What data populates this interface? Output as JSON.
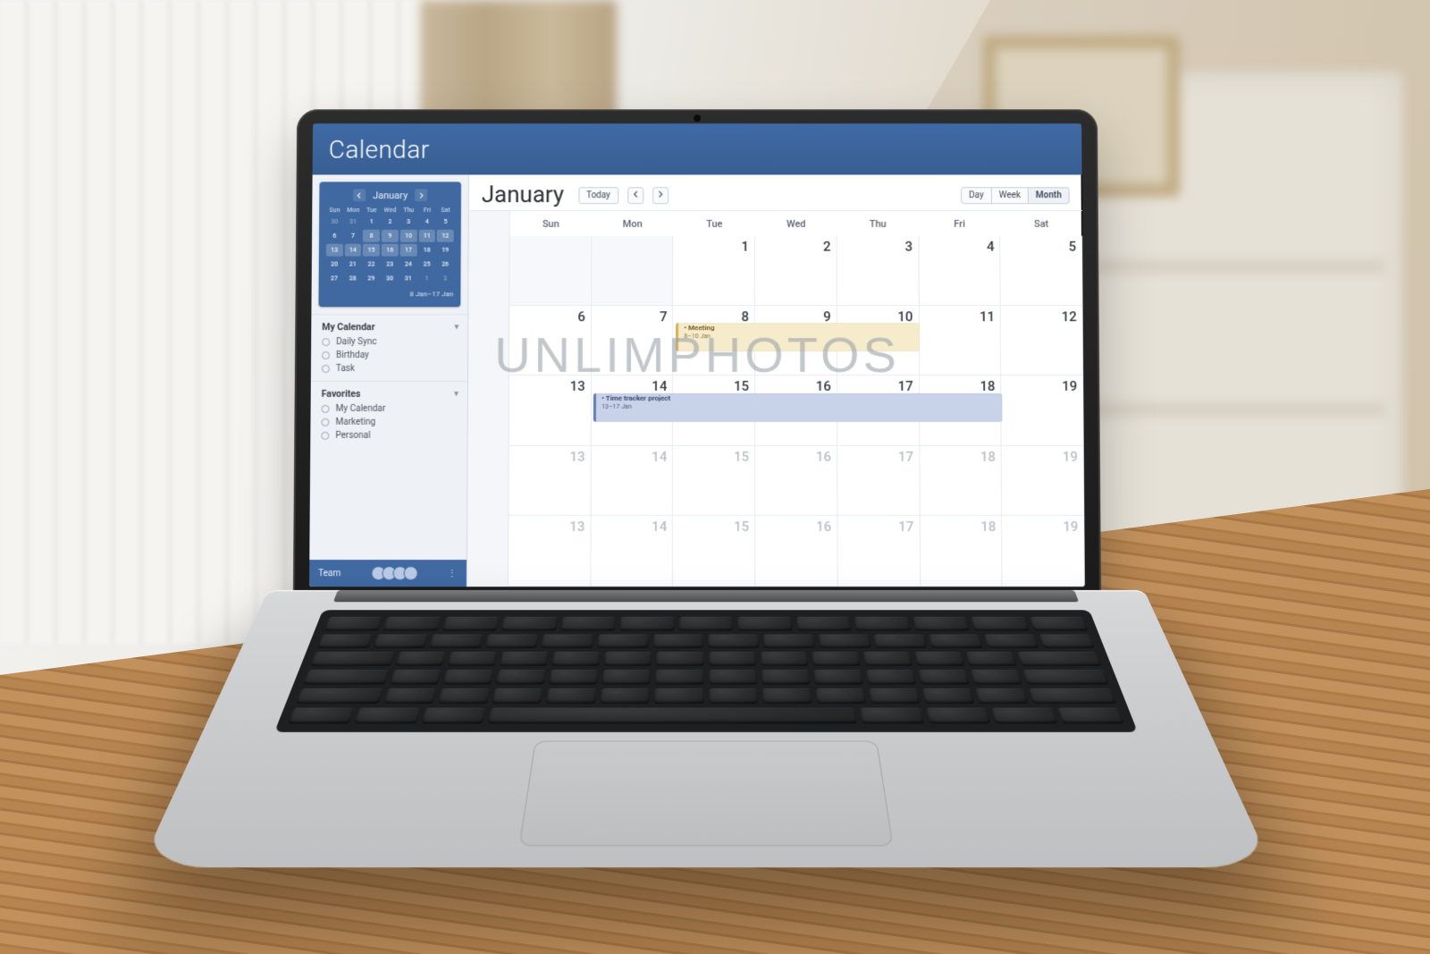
{
  "app_title": "Calendar",
  "watermark": {
    "main": "UNLIMPHOTOS",
    "corner": "UNL"
  },
  "mini": {
    "month": "January",
    "dow": [
      "Sun",
      "Mon",
      "Tue",
      "Wed",
      "Thu",
      "Fri",
      "Sat"
    ],
    "range_label": "8 Jan–17 Jan",
    "cells": [
      {
        "n": "30",
        "dim": true
      },
      {
        "n": "31",
        "dim": true
      },
      {
        "n": "1"
      },
      {
        "n": "2"
      },
      {
        "n": "3"
      },
      {
        "n": "4"
      },
      {
        "n": "5"
      },
      {
        "n": "6"
      },
      {
        "n": "7"
      },
      {
        "n": "8",
        "hl": true
      },
      {
        "n": "9",
        "hl": true
      },
      {
        "n": "10",
        "hl": true
      },
      {
        "n": "11",
        "hl": true
      },
      {
        "n": "12",
        "hl": true
      },
      {
        "n": "13",
        "hl": true
      },
      {
        "n": "14",
        "hl": true
      },
      {
        "n": "15",
        "hl": true
      },
      {
        "n": "16",
        "hl": true
      },
      {
        "n": "17",
        "hl": true
      },
      {
        "n": "18"
      },
      {
        "n": "19"
      },
      {
        "n": "20"
      },
      {
        "n": "21"
      },
      {
        "n": "22"
      },
      {
        "n": "23"
      },
      {
        "n": "24"
      },
      {
        "n": "25"
      },
      {
        "n": "26"
      },
      {
        "n": "27"
      },
      {
        "n": "28"
      },
      {
        "n": "29"
      },
      {
        "n": "30"
      },
      {
        "n": "31"
      },
      {
        "n": "1",
        "dim": true
      },
      {
        "n": "2",
        "dim": true
      }
    ]
  },
  "sections": [
    {
      "title": "My Calendar",
      "items": [
        "Daily Sync",
        "Birthday",
        "Task"
      ]
    },
    {
      "title": "Favorites",
      "items": [
        "My Calendar",
        "Marketing",
        "Personal"
      ]
    }
  ],
  "team_label": "Team",
  "toolbar": {
    "month": "January",
    "today": "Today",
    "views": [
      "Day",
      "Week",
      "Month"
    ],
    "active_view": "Month"
  },
  "dow": [
    "Sun",
    "Mon",
    "Tue",
    "Wed",
    "Thu",
    "Fri",
    "Sat"
  ],
  "weeks": [
    [
      {
        "n": ""
      },
      {
        "n": ""
      },
      {
        "n": "1"
      },
      {
        "n": "2"
      },
      {
        "n": "3"
      },
      {
        "n": "4"
      },
      {
        "n": "5"
      }
    ],
    [
      {
        "n": "6"
      },
      {
        "n": "7"
      },
      {
        "n": "8"
      },
      {
        "n": "9"
      },
      {
        "n": "10"
      },
      {
        "n": "11"
      },
      {
        "n": "12"
      }
    ],
    [
      {
        "n": "13"
      },
      {
        "n": "14"
      },
      {
        "n": "15"
      },
      {
        "n": "16"
      },
      {
        "n": "17"
      },
      {
        "n": "18"
      },
      {
        "n": "19"
      }
    ],
    [
      {
        "n": "13",
        "dim": true
      },
      {
        "n": "14",
        "dim": true
      },
      {
        "n": "15",
        "dim": true
      },
      {
        "n": "16",
        "dim": true
      },
      {
        "n": "17",
        "dim": true
      },
      {
        "n": "18",
        "dim": true
      },
      {
        "n": "19",
        "dim": true
      }
    ],
    [
      {
        "n": "13",
        "dim": true
      },
      {
        "n": "14",
        "dim": true
      },
      {
        "n": "15",
        "dim": true
      },
      {
        "n": "16",
        "dim": true
      },
      {
        "n": "17",
        "dim": true
      },
      {
        "n": "18",
        "dim": true
      },
      {
        "n": "19",
        "dim": true
      }
    ]
  ],
  "events": [
    {
      "kind": "meeting",
      "title": "Meeting",
      "dates": "8–10 Jan",
      "row": 1,
      "col_start": 2,
      "col_span": 3
    },
    {
      "kind": "project",
      "title": "Time tracker project",
      "dates": "13–17 Jan",
      "row": 2,
      "col_start": 1,
      "col_span": 5
    }
  ]
}
